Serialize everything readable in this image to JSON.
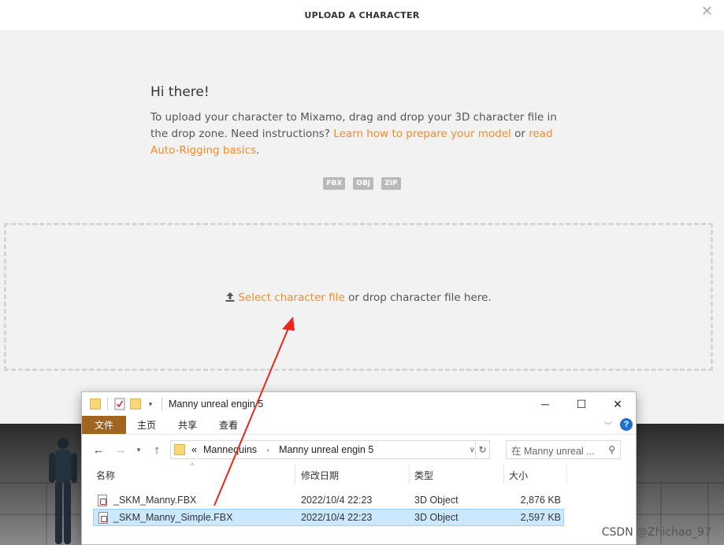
{
  "modal": {
    "title": "UPLOAD A CHARACTER",
    "close_icon": "close-icon",
    "greeting": "Hi there!",
    "intro_text": "To upload your character to Mixamo, drag and drop your 3D character file in the drop zone. Need instructions?",
    "link_prepare": "Learn how to prepare your model",
    "or_text": "or",
    "link_autorig": "read Auto-Rigging basics",
    "period": ".",
    "formats": [
      "FBX",
      "OBJ",
      "ZIP"
    ],
    "dropzone": {
      "upload_icon": "upload-icon",
      "select_link": "Select character file",
      "drop_text": "or drop character file here."
    },
    "accent_color": "#f08c2a"
  },
  "explorer": {
    "title": "Manny unreal engin 5",
    "window_buttons": [
      "─",
      "☐",
      "✕"
    ],
    "ribbon_tabs": [
      "文件",
      "主页",
      "共享",
      "查看"
    ],
    "address": {
      "prefix": "«",
      "crumbs": [
        "Mannequins",
        "Manny unreal engin 5"
      ]
    },
    "search_placeholder": "在 Manny unreal ...",
    "columns": [
      "名称",
      "修改日期",
      "类型",
      "大小"
    ],
    "files": [
      {
        "name": "_SKM_Manny.FBX",
        "date": "2022/10/4 22:23",
        "type": "3D Object",
        "size": "2,876 KB",
        "selected": false
      },
      {
        "name": "_SKM_Manny_Simple.FBX",
        "date": "2022/10/4 22:23",
        "type": "3D Object",
        "size": "2,597 KB",
        "selected": true
      }
    ]
  },
  "watermark": "CSDN @Zhichao_97"
}
